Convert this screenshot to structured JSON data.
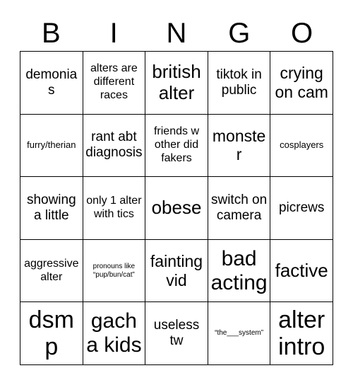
{
  "card": {
    "header_letters": [
      "B",
      "I",
      "N",
      "G",
      "O"
    ],
    "rows": [
      [
        {
          "text": "demonias",
          "size": "m"
        },
        {
          "text": "alters are different races",
          "size": "s"
        },
        {
          "text": "british alter",
          "size": "xl"
        },
        {
          "text": "tiktok in public",
          "size": "m"
        },
        {
          "text": "crying on cam",
          "size": "l"
        }
      ],
      [
        {
          "text": "furry/therian",
          "size": "xs"
        },
        {
          "text": "rant abt diagnosis",
          "size": "m"
        },
        {
          "text": "friends w other did fakers",
          "size": "s"
        },
        {
          "text": "monster",
          "size": "l"
        },
        {
          "text": "cosplayers",
          "size": "xs"
        }
      ],
      [
        {
          "text": "showing a little",
          "size": "m"
        },
        {
          "text": "only 1 alter with tics",
          "size": "s"
        },
        {
          "text": "obese",
          "size": "xl"
        },
        {
          "text": "switch on camera",
          "size": "m"
        },
        {
          "text": "picrews",
          "size": "m"
        }
      ],
      [
        {
          "text": "aggressive alter",
          "size": "s"
        },
        {
          "text": "pronouns like “pup/bun/cat”",
          "size": "xxs"
        },
        {
          "text": "fainting vid",
          "size": "l"
        },
        {
          "text": "bad acting",
          "size": "xxl"
        },
        {
          "text": "factive",
          "size": "xl"
        }
      ],
      [
        {
          "text": "dsmp",
          "size": "huge"
        },
        {
          "text": "gacha kids",
          "size": "xxl"
        },
        {
          "text": "useless tw",
          "size": "m"
        },
        {
          "text": "“the___system”",
          "size": "xxs"
        },
        {
          "text": "alter intro",
          "size": "huge"
        }
      ]
    ]
  },
  "colors": {
    "background": "#ffffff",
    "text": "#000000",
    "grid_line": "#000000"
  }
}
